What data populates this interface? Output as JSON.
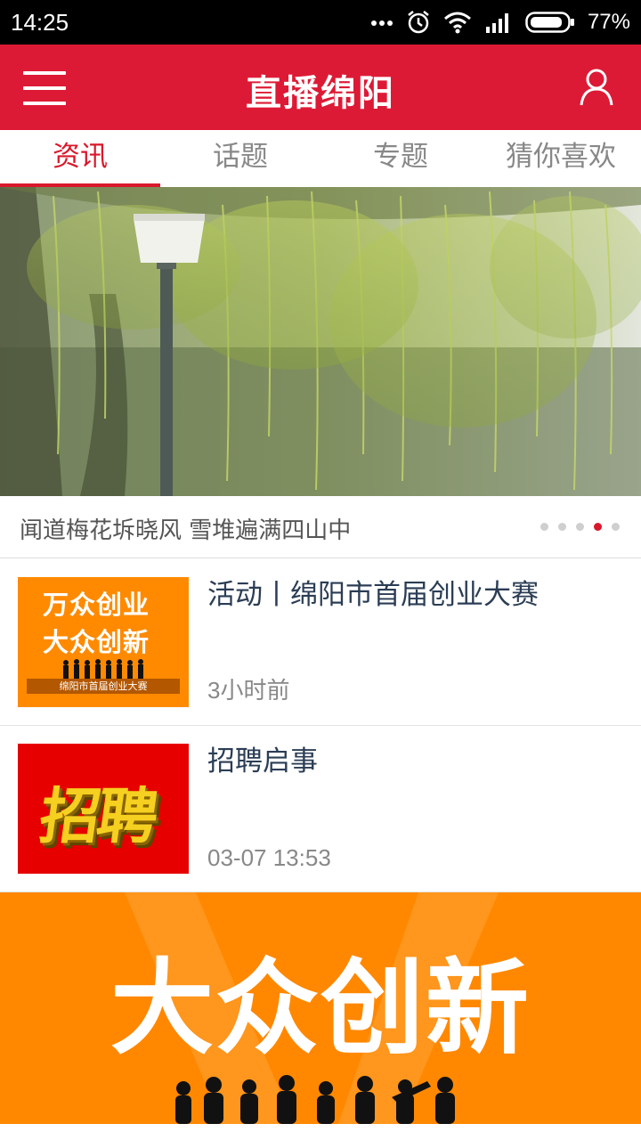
{
  "status_bar": {
    "time": "14:25",
    "battery": "77%"
  },
  "header": {
    "title": "直播绵阳",
    "menu_icon": "menu-icon",
    "user_icon": "user-icon",
    "brand_color": "#dd1a35"
  },
  "tabs": [
    {
      "label": "资讯",
      "active": true
    },
    {
      "label": "话题",
      "active": false
    },
    {
      "label": "专题",
      "active": false
    },
    {
      "label": "猜你喜欢",
      "active": false
    }
  ],
  "carousel": {
    "caption": "闻道梅花坼晓风 雪堆遍满四山中",
    "dot_count": 5,
    "active_index": 3
  },
  "news": [
    {
      "title": "活动丨绵阳市首届创业大赛",
      "time": "3小时前",
      "thumb_line1": "万众创业",
      "thumb_line2": "大众创新",
      "thumb_strip": "绵阳市首届创业大赛"
    },
    {
      "title": "招聘启事",
      "time": "03-07 13:53",
      "thumb_text": "招聘"
    }
  ],
  "banner": {
    "text": "大众创新"
  }
}
